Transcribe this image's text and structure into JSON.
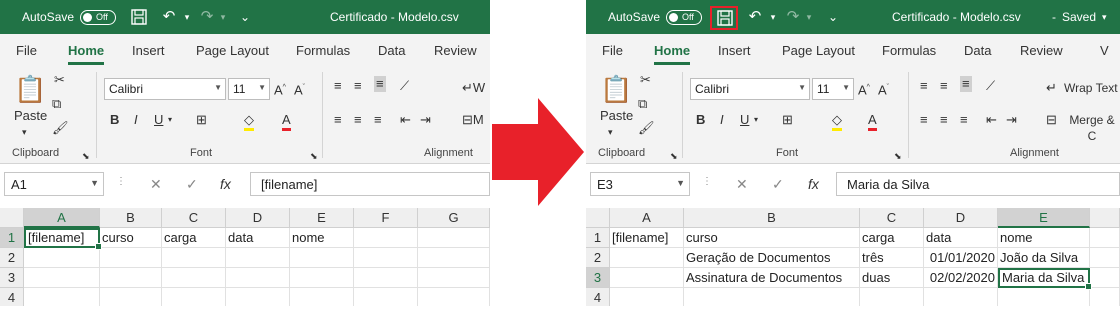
{
  "left": {
    "title": "Certificado - Modelo.csv",
    "autosave_label": "AutoSave",
    "autosave_state": "Off",
    "tabs": [
      "File",
      "Home",
      "Insert",
      "Page Layout",
      "Formulas",
      "Data",
      "Review"
    ],
    "font_name": "Calibri",
    "font_size": "11",
    "group_clipboard": "Clipboard",
    "group_font": "Font",
    "group_alignment": "Alignment",
    "paste_label": "Paste",
    "namebox": "A1",
    "formula": "[filename]",
    "columns": [
      "A",
      "B",
      "C",
      "D",
      "E",
      "F",
      "G"
    ],
    "rows": [
      "1",
      "2",
      "3",
      "4"
    ],
    "cells": {
      "A1": "[filename]",
      "B1": "curso",
      "C1": "carga",
      "D1": "data",
      "E1": "nome"
    }
  },
  "right": {
    "title": "Certificado - Modelo.csv",
    "saved_label": "Saved",
    "autosave_label": "AutoSave",
    "autosave_state": "Off",
    "tabs": [
      "File",
      "Home",
      "Insert",
      "Page Layout",
      "Formulas",
      "Data",
      "Review"
    ],
    "font_name": "Calibri",
    "font_size": "11",
    "group_clipboard": "Clipboard",
    "group_font": "Font",
    "group_alignment": "Alignment",
    "paste_label": "Paste",
    "wrap_text": "Wrap Text",
    "merge": "Merge & C",
    "namebox": "E3",
    "formula": "Maria da Silva",
    "columns": [
      "A",
      "B",
      "C",
      "D",
      "E"
    ],
    "rows": [
      "1",
      "2",
      "3",
      "4"
    ],
    "cells": {
      "A1": "[filename]",
      "B1": "curso",
      "C1": "carga",
      "D1": "data",
      "E1": "nome",
      "B2": "Geração de Documentos",
      "C2": "três",
      "D2": "01/01/2020",
      "E2": "João da Silva",
      "B3": "Assinatura de Documentos",
      "C3": "duas",
      "D3": "02/02/2020",
      "E3": "Maria da Silva"
    }
  },
  "colors": {
    "excel_green": "#217346",
    "arrow_red": "#e8212a",
    "highlight": "#e8212a"
  }
}
